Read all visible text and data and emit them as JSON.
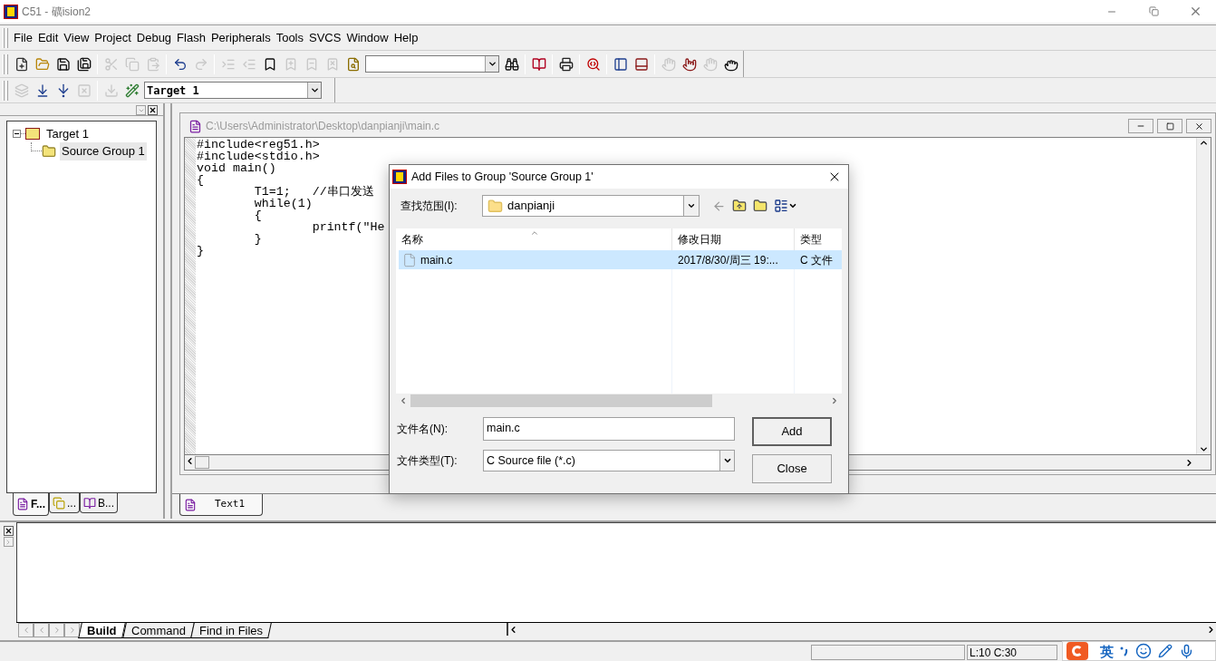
{
  "window": {
    "title": "C51  - 礦ision2"
  },
  "menu": [
    "File",
    "Edit",
    "View",
    "Project",
    "Debug",
    "Flash",
    "Peripherals",
    "Tools",
    "SVCS",
    "Window",
    "Help"
  ],
  "toolbar_1": [
    {
      "kind": "new",
      "disabled": false
    },
    {
      "kind": "open",
      "disabled": false
    },
    {
      "kind": "save",
      "disabled": false
    },
    {
      "kind": "save-all",
      "disabled": false
    },
    {
      "kind": "separator"
    },
    {
      "kind": "cut",
      "disabled": true
    },
    {
      "kind": "copy",
      "disabled": true
    },
    {
      "kind": "paste",
      "disabled": true
    },
    {
      "kind": "separator"
    },
    {
      "kind": "undo",
      "disabled": false
    },
    {
      "kind": "redo",
      "disabled": true
    },
    {
      "kind": "separator"
    },
    {
      "kind": "indent",
      "disabled": true
    },
    {
      "kind": "outdent",
      "disabled": true
    },
    {
      "kind": "bookmark",
      "disabled": false
    },
    {
      "kind": "bookmark-next",
      "disabled": true
    },
    {
      "kind": "bookmark-prev",
      "disabled": true
    },
    {
      "kind": "bookmark-clear",
      "disabled": true
    },
    {
      "kind": "find-files",
      "disabled": false
    },
    {
      "kind": "find-combo"
    },
    {
      "kind": "binoculars",
      "disabled": false
    },
    {
      "kind": "separator"
    },
    {
      "kind": "browse",
      "disabled": false
    },
    {
      "kind": "separator"
    },
    {
      "kind": "print",
      "disabled": false
    },
    {
      "kind": "separator"
    },
    {
      "kind": "debug",
      "disabled": false
    },
    {
      "kind": "separator"
    },
    {
      "kind": "project-window",
      "disabled": false
    },
    {
      "kind": "output-window",
      "disabled": false
    },
    {
      "kind": "separator"
    },
    {
      "kind": "hand",
      "disabled": true
    },
    {
      "kind": "hand-off",
      "disabled": false
    },
    {
      "kind": "hand-gray",
      "disabled": true
    },
    {
      "kind": "hand-grab",
      "disabled": false
    }
  ],
  "toolbar_2": [
    {
      "kind": "translate",
      "disabled": true
    },
    {
      "kind": "build",
      "disabled": false
    },
    {
      "kind": "rebuild",
      "disabled": false
    },
    {
      "kind": "stop",
      "disabled": true
    },
    {
      "kind": "separator"
    },
    {
      "kind": "load",
      "disabled": true
    },
    {
      "kind": "options",
      "disabled": false
    },
    {
      "kind": "target-select",
      "value": "Target 1"
    }
  ],
  "project_panel": {
    "tree": [
      {
        "label": "Target 1",
        "expanded": true,
        "selected": false,
        "children": [
          {
            "label": "Source Group 1",
            "selected": true
          }
        ]
      }
    ],
    "tabs": [
      {
        "label": "F...",
        "selected": true
      },
      {
        "label": "...",
        "selected": false
      },
      {
        "label": "B...",
        "selected": false
      }
    ]
  },
  "editor": {
    "title": "C:\\Users\\Administrator\\Desktop\\danpianji\\main.c",
    "lines": [
      "#include<reg51.h>",
      "#include<stdio.h>",
      "void main()",
      "{",
      "\tT1=1;   //串口发送",
      "\twhile(1)",
      "\t{",
      "\t\tprintf(\"He",
      "\t}",
      "}"
    ],
    "tabs": [
      {
        "label": "Text1",
        "selected": true
      }
    ]
  },
  "output": {
    "tabs": [
      {
        "label": "Build",
        "selected": true
      },
      {
        "label": "Command",
        "selected": false
      },
      {
        "label": "Find in Files",
        "selected": false
      }
    ]
  },
  "status_bar": {
    "position": "L:10 C:30"
  },
  "ime_bar": {
    "mode": "英"
  },
  "dialog": {
    "title": "Add Files to Group 'Source Group 1'",
    "look_in_label": "查找范围(I):",
    "look_in": "danpianji",
    "columns": [
      "名称",
      "修改日期",
      "类型"
    ],
    "files": [
      {
        "name": "main.c",
        "date": "2017/8/30/周三 19:...",
        "type": "C 文件",
        "selected": true
      }
    ],
    "file_name_label": "文件名(N):",
    "file_name": "main.c",
    "file_type_label": "文件类型(T):",
    "file_type": "C Source file (*.c)",
    "buttons": [
      "Add",
      "Close"
    ]
  }
}
